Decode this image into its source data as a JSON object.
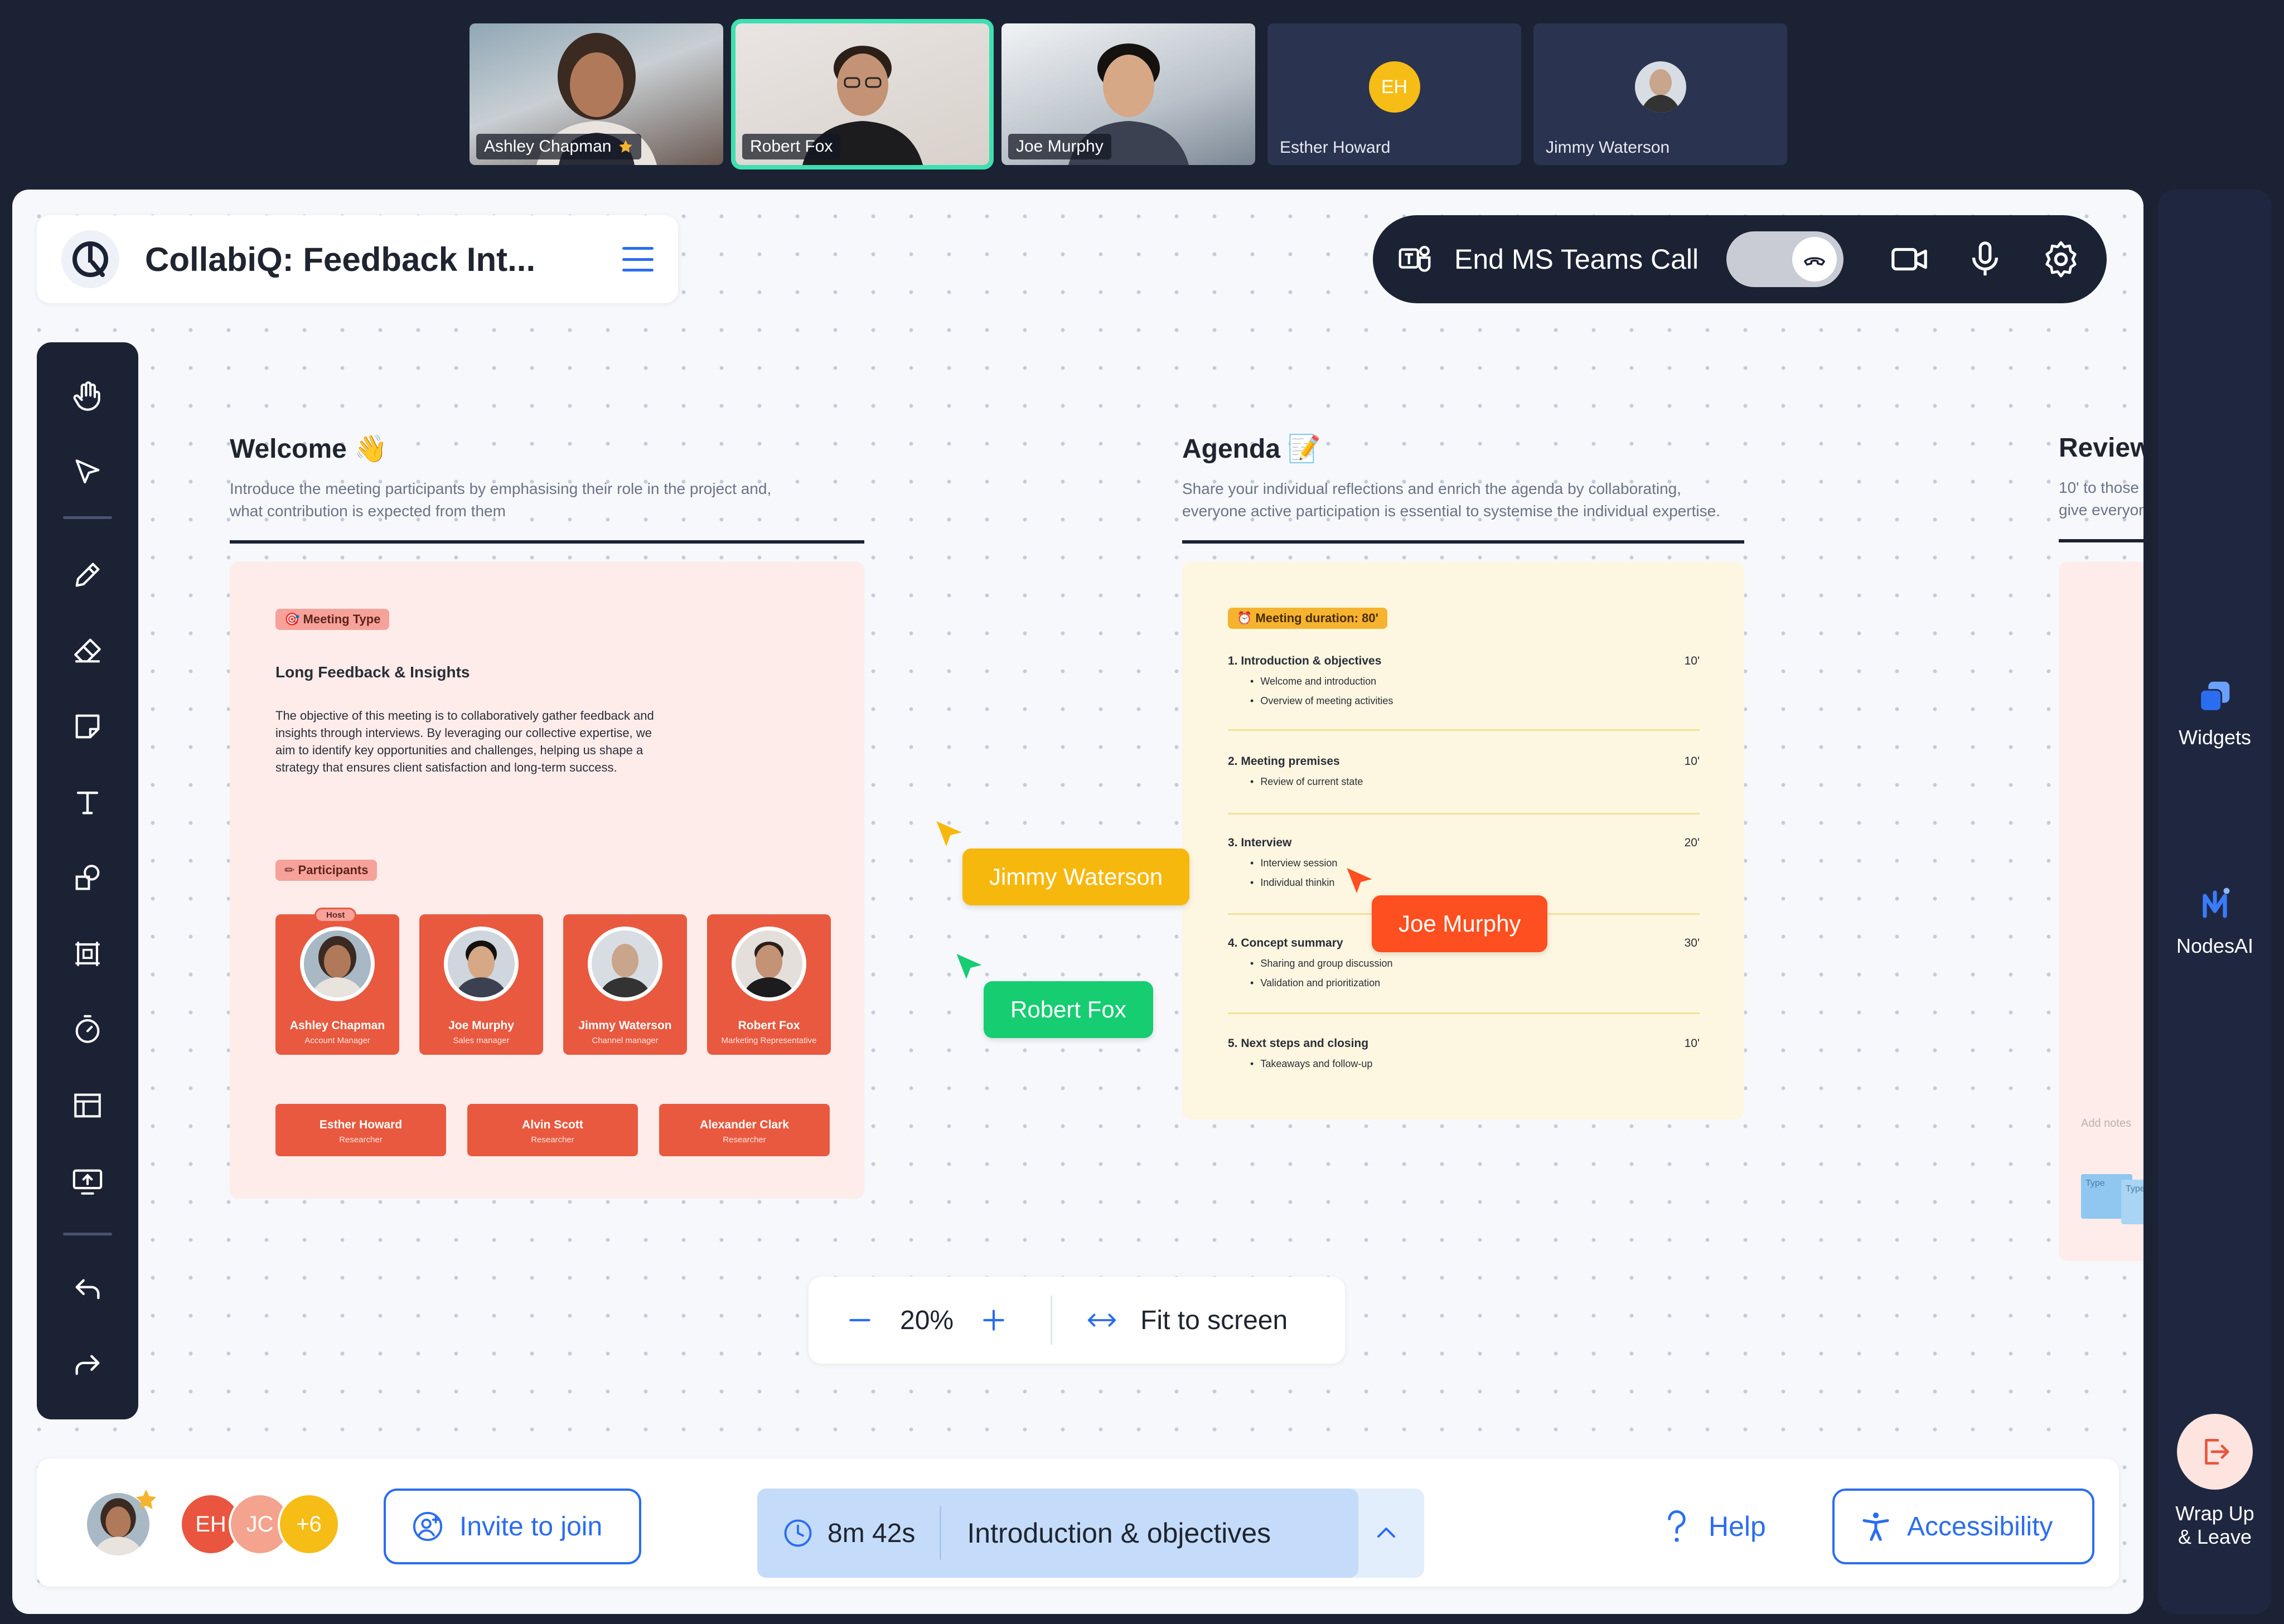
{
  "participants": [
    {
      "name": "Ashley Chapman",
      "host_star": true
    },
    {
      "name": "Robert Fox",
      "active": true
    },
    {
      "name": "Joe Murphy"
    },
    {
      "name": "Esther Howard",
      "initials": "EH"
    },
    {
      "name": "Jimmy Waterson"
    }
  ],
  "header": {
    "title": "CollabiQ: Feedback Int..."
  },
  "call": {
    "end_label": "End MS Teams Call"
  },
  "sections": {
    "welcome": {
      "title": "Welcome 👋",
      "desc_1": "Introduce the meeting participants by emphasising their role in the project and,",
      "desc_2": "what contribution is expected from them"
    },
    "agenda": {
      "title": "Agenda 📝",
      "desc_1": "Share your individual reflections and enrich the agenda by collaborating,",
      "desc_2": "everyone active participation is essential to systemise the individual expertise."
    },
    "review": {
      "title": "Review",
      "desc_1": "10' to those w",
      "desc_2": "give everyon"
    }
  },
  "welcome_card": {
    "meeting_type_tag": "🎯 Meeting Type",
    "meeting_type": "Long Feedback & Insights",
    "body_1": "The objective of this meeting is to collaboratively gather feedback and",
    "body_2": "insights through interviews. By leveraging our collective expertise, we",
    "body_3": "aim to identify key opportunities and challenges, helping us shape a",
    "body_4": "strategy that ensures client satisfaction and long-term success.",
    "participants_tag": "✏ Participants",
    "host_label": "Host",
    "people": [
      {
        "name": "Ashley Chapman",
        "role": "Account Manager"
      },
      {
        "name": "Joe Murphy",
        "role": "Sales manager"
      },
      {
        "name": "Jimmy Waterson",
        "role": "Channel manager"
      },
      {
        "name": "Robert Fox",
        "role": "Marketing Representative"
      }
    ],
    "researchers": [
      {
        "name": "Esther Howard",
        "role": "Researcher"
      },
      {
        "name": "Alvin Scott",
        "role": "Researcher"
      },
      {
        "name": "Alexander Clark",
        "role": "Researcher"
      }
    ]
  },
  "agenda_card": {
    "duration_tag": "⏰ Meeting duration: 80'",
    "items": [
      {
        "title": "1.  Introduction & objectives",
        "duration": "10'",
        "bullets": [
          "Welcome and introduction",
          "Overview of meeting activities"
        ]
      },
      {
        "title": "2.  Meeting premises",
        "duration": "10'",
        "bullets": [
          "Review of current state"
        ]
      },
      {
        "title": "3.  Interview",
        "duration": "20'",
        "bullets": [
          "Interview session",
          "Individual thinkin"
        ]
      },
      {
        "title": "4.  Concept summary",
        "duration": "30'",
        "bullets": [
          "Sharing and group discussion",
          "Validation and prioritization"
        ]
      },
      {
        "title": "5.  Next steps and closing",
        "duration": "10'",
        "bullets": [
          "Takeaways and follow-up"
        ]
      }
    ]
  },
  "review_card": {
    "notes_placeholder": "Add notes",
    "sticky_1": "Type",
    "sticky_2": "Type"
  },
  "cursors": [
    {
      "name": "Jimmy Waterson",
      "color": "#f7b80d"
    },
    {
      "name": "Robert Fox",
      "color": "#16cd72"
    },
    {
      "name": "Joe Murphy",
      "color": "#fd4f1f"
    }
  ],
  "zoom": {
    "value": "20%",
    "fit_label": "Fit to screen"
  },
  "bottom": {
    "avatars": [
      {
        "initials": "EH",
        "color": "#e9553f"
      },
      {
        "initials": "JC",
        "color": "#f3a38e"
      },
      {
        "initials": "+6",
        "color": "#f5bd15"
      }
    ],
    "invite_label": "Invite to join",
    "timer": "8m 42s",
    "current_topic": "Introduction & objectives",
    "help_label": "Help",
    "accessibility_label": "Accessibility"
  },
  "right_rail": {
    "widgets_label": "Widgets",
    "nodesai_label": "NodesAI",
    "leave_label_1": "Wrap Up",
    "leave_label_2": "& Leave"
  },
  "colors": {
    "accent": "#2b6df0",
    "dark": "#1b2234",
    "active_tile": "#3ee0b0"
  },
  "icons": [
    "hand-icon",
    "pointer-icon",
    "pencil-icon",
    "eraser-icon",
    "sticky-note-icon",
    "text-icon",
    "shapes-icon",
    "frame-icon",
    "timer-icon",
    "table-icon",
    "share-screen-icon",
    "undo-icon",
    "redo-icon",
    "video-icon",
    "mic-icon",
    "gear-icon",
    "hangup-icon",
    "menu-icon",
    "clock-icon",
    "chevron-up-icon",
    "help-icon",
    "accessibility-icon",
    "add-user-icon",
    "widgets-icon",
    "nodesai-icon",
    "exit-icon",
    "star-icon",
    "teams-icon"
  ]
}
